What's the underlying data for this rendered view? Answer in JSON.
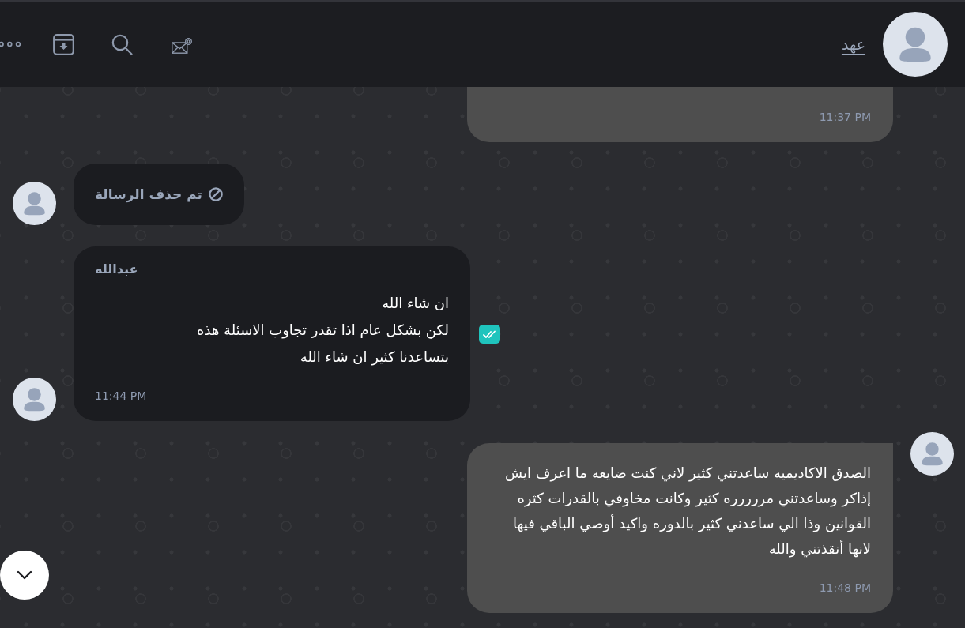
{
  "header": {
    "contact_name": "عهد"
  },
  "messages": [
    {
      "kind": "outgoing",
      "avatar": false,
      "time": "11:37 PM",
      "checked": false
    },
    {
      "kind": "deleted",
      "avatar": true,
      "text": "تم حذف الرسالة",
      "checked": false
    },
    {
      "kind": "incoming",
      "avatar": true,
      "sender": "عبدالله",
      "text": "ان شاء الله\nلكن بشكل عام اذا تقدر تجاوب الاسئلة هذه\nبتساعدنا كثير ان شاء الله",
      "time": "11:44 PM",
      "checked": true
    },
    {
      "kind": "outgoing",
      "avatar": true,
      "text": "الصدق الاكاديميه ساعدتني كثير لاني كنت ضايعه ما اعرف ايش إذاكر وساعدتني مررررره كثير وكانت مخاوفي بالقدرات كثره القوانين وذا الي ساعدني كثير بالدوره واكيد أوصي الباقي فيها لانها أنقذتني والله",
      "time": "11:48 PM",
      "checked": false
    }
  ]
}
